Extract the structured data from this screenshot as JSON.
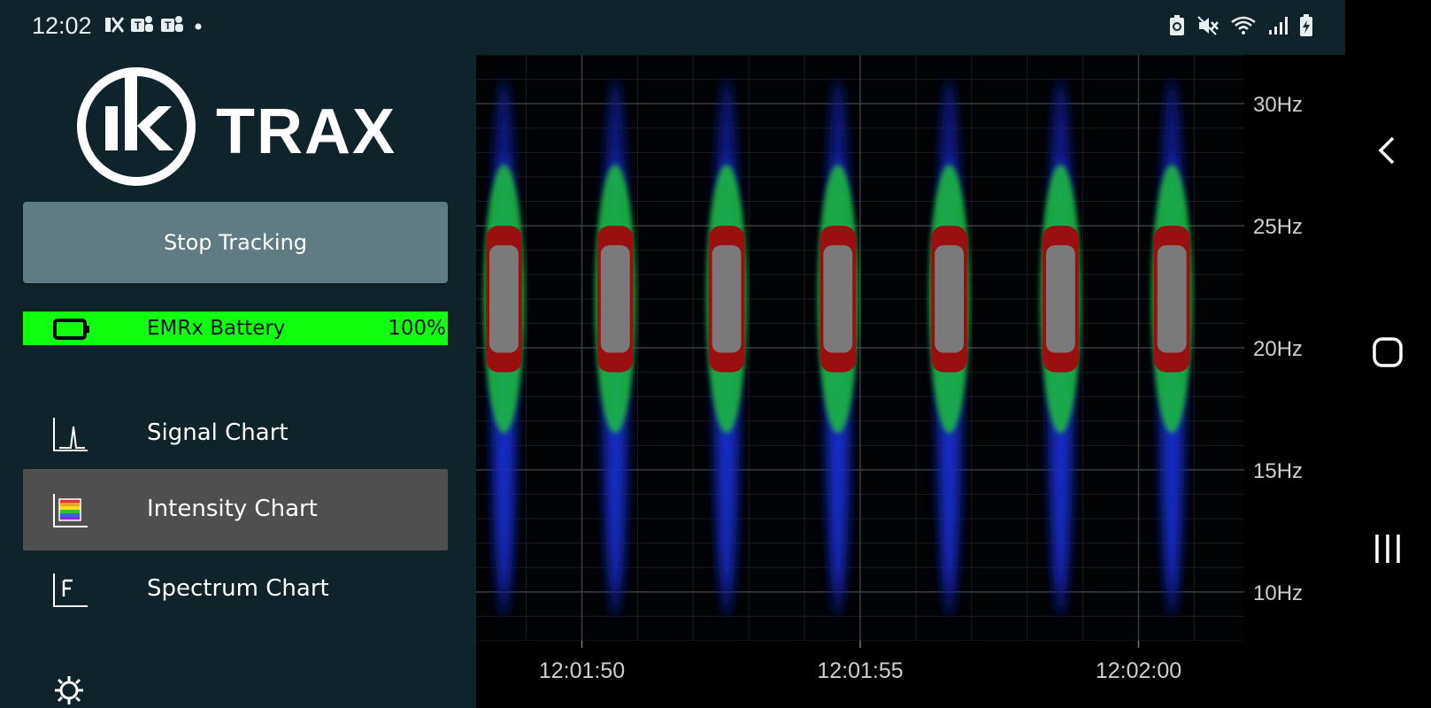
{
  "status_bar": {
    "time": "12:02",
    "left_icons": [
      "kx-notification-icon",
      "teams-icon",
      "teams-icon",
      "dot-icon"
    ],
    "right_icons": [
      "recycle-icon",
      "mute-icon",
      "wifi-icon",
      "signal-icon",
      "battery-charging-icon"
    ]
  },
  "app": {
    "logo_text": "TRAX",
    "stop_button_label": "Stop Tracking",
    "battery": {
      "label": "EMRx Battery",
      "percent": "100%",
      "level": 1.0,
      "color": "#11ff11"
    },
    "nav": [
      {
        "label": "Signal Chart",
        "icon": "signal-chart-icon",
        "active": false
      },
      {
        "label": "Intensity Chart",
        "icon": "intensity-chart-icon",
        "active": true
      },
      {
        "label": "Spectrum Chart",
        "icon": "spectrum-chart-icon",
        "active": false
      }
    ],
    "colors": {
      "background": "#10232a",
      "button": "#617b82",
      "active_item": "#4f4f4f"
    }
  },
  "chart_data": {
    "type": "heatmap",
    "title": "",
    "xlabel": "",
    "ylabel": "",
    "x_tick_labels": [
      "12:01:50",
      "12:01:55",
      "12:02:00"
    ],
    "x_ticks_seconds": [
      50,
      55,
      60
    ],
    "xlim_seconds": [
      48.1,
      61.9
    ],
    "y_tick_labels": [
      "30Hz",
      "25Hz",
      "20Hz",
      "15Hz",
      "10Hz"
    ],
    "y_ticks": [
      30,
      25,
      20,
      15,
      10
    ],
    "ylim": [
      8.0,
      32.0
    ],
    "grid": true,
    "pulse_centers_seconds": [
      48.6,
      50.6,
      52.6,
      54.6,
      56.6,
      58.6,
      60.6
    ],
    "peak_band_hz": [
      19.8,
      24.2
    ],
    "colormap": [
      "#000000",
      "#0a1a8c",
      "#1a3cff",
      "#1fbf3a",
      "#9a1010",
      "#7a7a7a"
    ]
  },
  "nav_bar": {
    "buttons": [
      "back-icon",
      "home-icon",
      "recents-icon"
    ]
  }
}
